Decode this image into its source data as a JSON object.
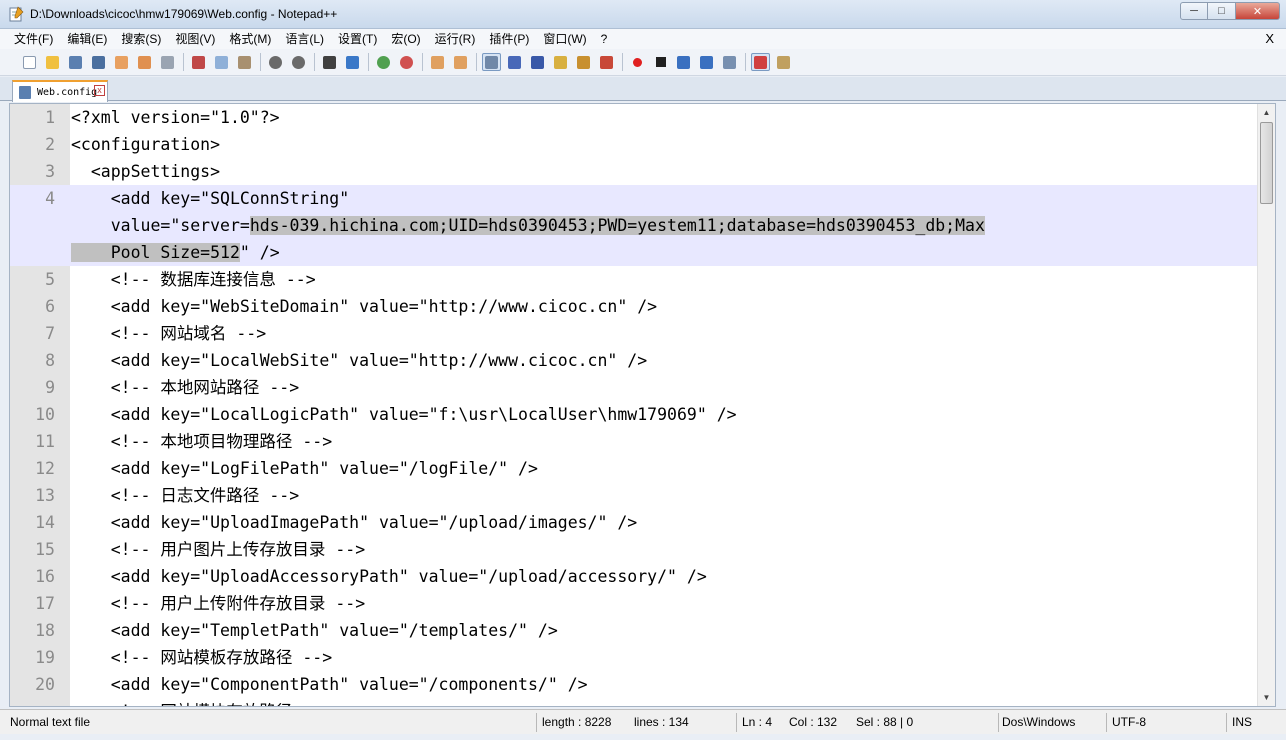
{
  "window": {
    "title": "D:\\Downloads\\cicoc\\hmw179069\\Web.config - Notepad++",
    "minimize_glyph": "─",
    "maximize_glyph": "□",
    "close_glyph": "✕"
  },
  "menu": {
    "items": [
      "文件(F)",
      "编辑(E)",
      "搜索(S)",
      "视图(V)",
      "格式(M)",
      "语言(L)",
      "设置(T)",
      "宏(O)",
      "运行(R)",
      "插件(P)",
      "窗口(W)",
      "?"
    ],
    "close": "X"
  },
  "tab": {
    "label": "Web.config",
    "close": "x"
  },
  "editor": {
    "rows": [
      {
        "ln": "1",
        "code": "<?xml version=\"1.0\"?>"
      },
      {
        "ln": "2",
        "code": "<configuration>"
      },
      {
        "ln": "3",
        "code": "  <appSettings>"
      },
      {
        "ln": "4",
        "code": "    <add key=\"SQLConnString\""
      },
      {
        "ln": "",
        "code_pre": "    value=\"server=",
        "code_sel": "hds-039.hichina.com;UID=hds0390453;PWD=yestem11;database=hds0390453_db;Max"
      },
      {
        "ln": "",
        "code_sel": "    Pool Size=512",
        "code_post": "\" />"
      },
      {
        "ln": "5",
        "code": "    <!-- 数据库连接信息 -->"
      },
      {
        "ln": "6",
        "code": "    <add key=\"WebSiteDomain\" value=\"http://www.cicoc.cn\" />"
      },
      {
        "ln": "7",
        "code": "    <!-- 网站域名 -->"
      },
      {
        "ln": "8",
        "code": "    <add key=\"LocalWebSite\" value=\"http://www.cicoc.cn\" />"
      },
      {
        "ln": "9",
        "code": "    <!-- 本地网站路径 -->"
      },
      {
        "ln": "10",
        "code": "    <add key=\"LocalLogicPath\" value=\"f:\\usr\\LocalUser\\hmw179069\" />"
      },
      {
        "ln": "11",
        "code": "    <!-- 本地项目物理路径 -->"
      },
      {
        "ln": "12",
        "code": "    <add key=\"LogFilePath\" value=\"/logFile/\" />"
      },
      {
        "ln": "13",
        "code": "    <!-- 日志文件路径 -->"
      },
      {
        "ln": "14",
        "code": "    <add key=\"UploadImagePath\" value=\"/upload/images/\" />"
      },
      {
        "ln": "15",
        "code": "    <!-- 用户图片上传存放目录 -->"
      },
      {
        "ln": "16",
        "code": "    <add key=\"UploadAccessoryPath\" value=\"/upload/accessory/\" />"
      },
      {
        "ln": "17",
        "code": "    <!-- 用户上传附件存放目录 -->"
      },
      {
        "ln": "18",
        "code": "    <add key=\"TempletPath\" value=\"/templates/\" />"
      },
      {
        "ln": "19",
        "code": "    <!-- 网站模板存放路径 -->"
      },
      {
        "ln": "20",
        "code": "    <add key=\"ComponentPath\" value=\"/components/\" />"
      },
      {
        "ln": "",
        "code": "    <!-- 网站模块存放路径"
      }
    ]
  },
  "status": {
    "file_type": "Normal text file",
    "length": "length : 8228",
    "lines": "lines : 134",
    "ln": "Ln : 4",
    "col": "Col : 132",
    "sel": "Sel : 88 | 0",
    "eol": "Dos\\Windows",
    "encoding": "UTF-8",
    "mode": "INS"
  },
  "toolbar_icons": [
    "new-file-icon",
    "open-file-icon",
    "save-icon",
    "save-all-icon",
    "close-icon",
    "close-all-icon",
    "print-icon",
    "cut-icon",
    "copy-icon",
    "paste-icon",
    "undo-icon",
    "redo-icon",
    "find-icon",
    "replace-icon",
    "zoom-in-icon",
    "zoom-out-icon",
    "sync-v-icon",
    "sync-h-icon",
    "word-wrap-icon",
    "show-all-chars-icon",
    "indent-guide-icon",
    "user-lang-icon",
    "doc-map-icon",
    "function-list-icon",
    "record-macro-icon",
    "stop-macro-icon",
    "play-macro-icon",
    "run-multiple-macro-icon",
    "save-macro-icon",
    "spell-check-icon",
    "spell-options-icon"
  ],
  "colors": {
    "current_line": "#e8e8ff",
    "selection": "#c0c0c0",
    "gutter": "#e4e4e4",
    "tab_accent": "#f0a030",
    "spell_error": "#d02020"
  }
}
